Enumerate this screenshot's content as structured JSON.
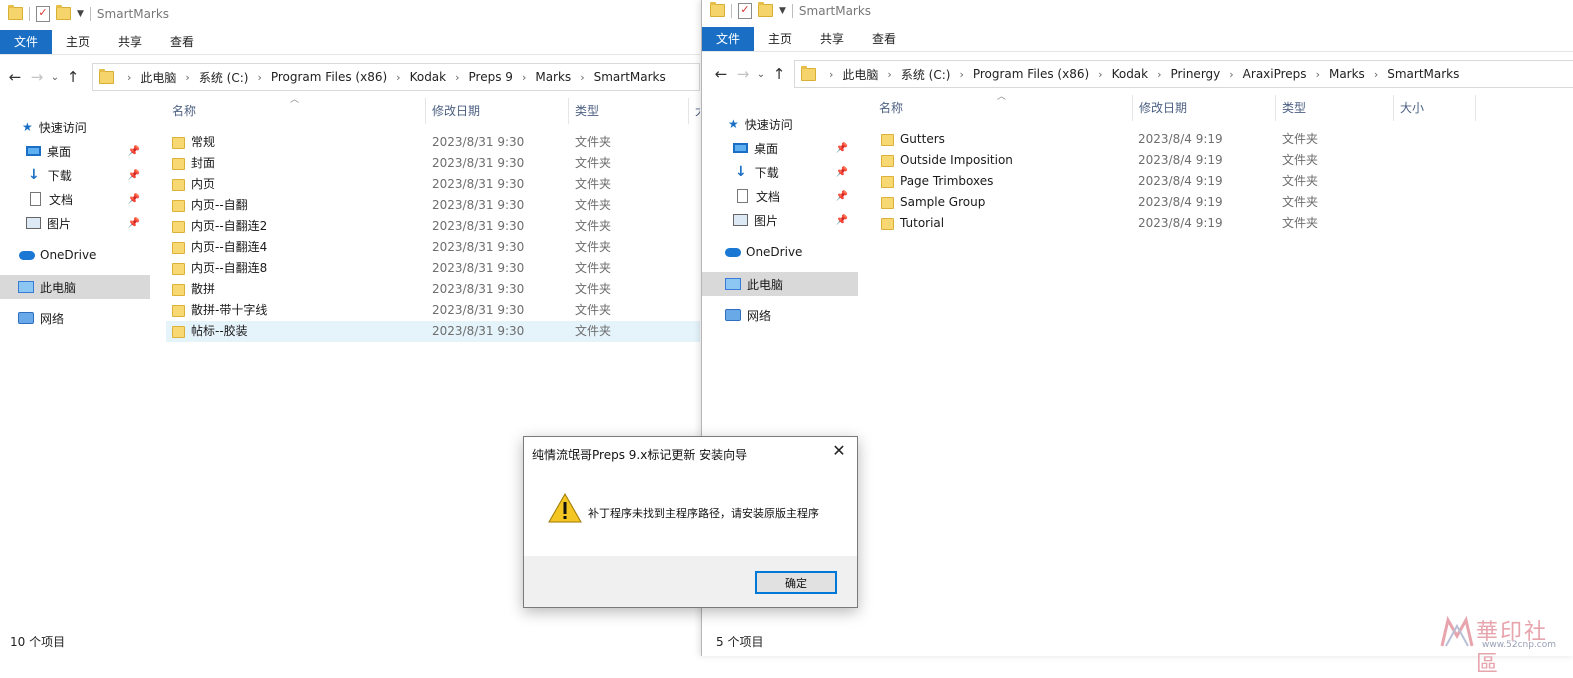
{
  "left_window": {
    "title": "SmartMarks",
    "ribbon_tabs": [
      "文件",
      "主页",
      "共享",
      "查看"
    ],
    "breadcrumbs": [
      "此电脑",
      "系统 (C:)",
      "Program Files (x86)",
      "Kodak",
      "Preps 9",
      "Marks",
      "SmartMarks"
    ],
    "nav": {
      "quick_access": "快速访问",
      "desktop": "桌面",
      "downloads": "下载",
      "documents": "文档",
      "pictures": "图片",
      "onedrive": "OneDrive",
      "this_pc": "此电脑",
      "network": "网络"
    },
    "columns": {
      "name": "名称",
      "date": "修改日期",
      "type": "类型",
      "size": "大"
    },
    "files": [
      {
        "name": "常规",
        "date": "2023/8/31 9:30",
        "type": "文件夹"
      },
      {
        "name": "封面",
        "date": "2023/8/31 9:30",
        "type": "文件夹"
      },
      {
        "name": "内页",
        "date": "2023/8/31 9:30",
        "type": "文件夹"
      },
      {
        "name": "内页--自翻",
        "date": "2023/8/31 9:30",
        "type": "文件夹"
      },
      {
        "name": "内页--自翻连2",
        "date": "2023/8/31 9:30",
        "type": "文件夹"
      },
      {
        "name": "内页--自翻连4",
        "date": "2023/8/31 9:30",
        "type": "文件夹"
      },
      {
        "name": "内页--自翻连8",
        "date": "2023/8/31 9:30",
        "type": "文件夹"
      },
      {
        "name": "散拼",
        "date": "2023/8/31 9:30",
        "type": "文件夹"
      },
      {
        "name": "散拼-带十字线",
        "date": "2023/8/31 9:30",
        "type": "文件夹"
      },
      {
        "name": "帖标--胶装",
        "date": "2023/8/31 9:30",
        "type": "文件夹"
      }
    ],
    "status": "10 个项目"
  },
  "right_window": {
    "title": "SmartMarks",
    "ribbon_tabs": [
      "文件",
      "主页",
      "共享",
      "查看"
    ],
    "breadcrumbs": [
      "此电脑",
      "系统 (C:)",
      "Program Files (x86)",
      "Kodak",
      "Prinergy",
      "AraxiPreps",
      "Marks",
      "SmartMarks"
    ],
    "nav": {
      "quick_access": "快速访问",
      "desktop": "桌面",
      "downloads": "下载",
      "documents": "文档",
      "pictures": "图片",
      "onedrive": "OneDrive",
      "this_pc": "此电脑",
      "network": "网络"
    },
    "columns": {
      "name": "名称",
      "date": "修改日期",
      "type": "类型",
      "size": "大小"
    },
    "files": [
      {
        "name": "Gutters",
        "date": "2023/8/4 9:19",
        "type": "文件夹"
      },
      {
        "name": "Outside Imposition",
        "date": "2023/8/4 9:19",
        "type": "文件夹"
      },
      {
        "name": "Page Trimboxes",
        "date": "2023/8/4 9:19",
        "type": "文件夹"
      },
      {
        "name": "Sample Group",
        "date": "2023/8/4 9:19",
        "type": "文件夹"
      },
      {
        "name": "Tutorial",
        "date": "2023/8/4 9:19",
        "type": "文件夹"
      }
    ],
    "status": "5 个项目"
  },
  "dialog": {
    "title": "纯情流氓哥Preps 9.x标记更新 安装向导",
    "message": "补丁程序未找到主程序路径，请安装原版主程序",
    "ok_label": "确定",
    "close_glyph": "✕"
  },
  "watermark": {
    "text": "華印社區",
    "url": "www.52cnp.com"
  },
  "colors": {
    "accent": "#1a6fc4",
    "selection": "#e5f3fb",
    "nav_selected": "#d9d9d9",
    "folder": "#f7d872",
    "warning": "#f3c623"
  }
}
